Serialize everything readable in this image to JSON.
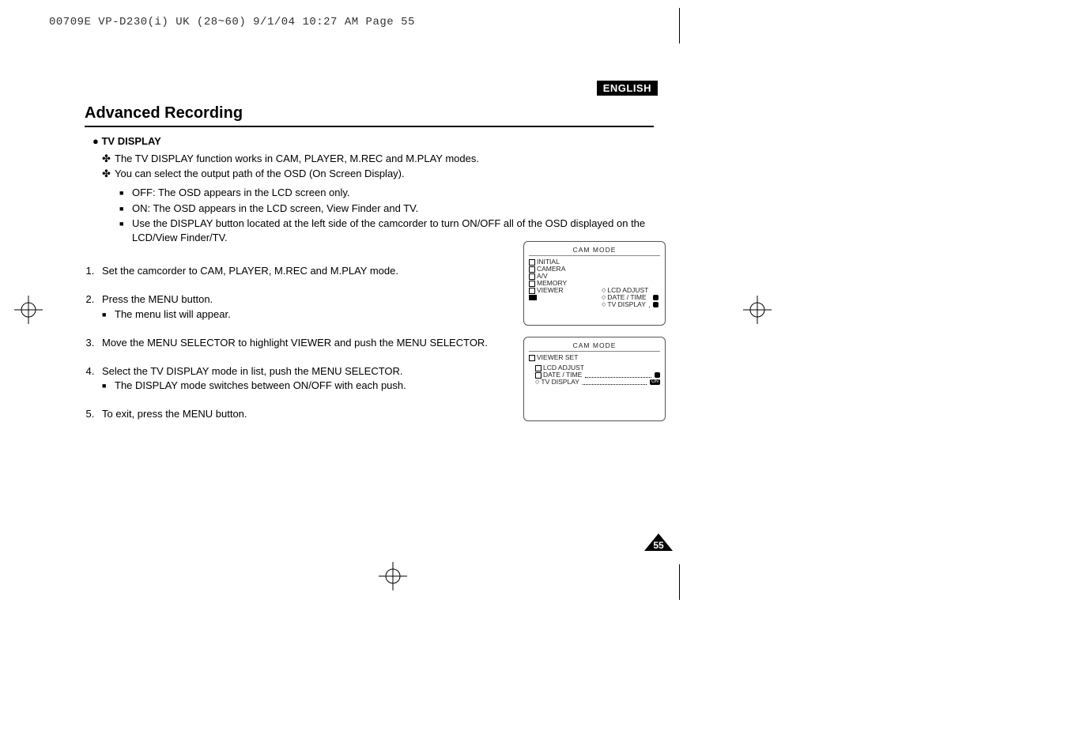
{
  "print_header": "00709E VP-D230(i) UK (28~60)  9/1/04 10:27 AM  Page 55",
  "language_badge": "ENGLISH",
  "section_title": "Advanced Recording",
  "sub_heading": "TV DISPLAY",
  "intro_bullets": [
    "The TV DISPLAY function works in CAM, PLAYER, M.REC and M.PLAY modes.",
    "You can select the output path of the OSD (On Screen Display)."
  ],
  "intro_squares": [
    "OFF: The OSD appears in the LCD screen only.",
    "ON: The OSD appears in the LCD screen, View Finder and TV.",
    "Use the DISPLAY button located at the left side of the camcorder to turn ON/OFF all of the OSD displayed on the LCD/View Finder/TV."
  ],
  "steps": [
    {
      "text": "Set the camcorder to CAM, PLAYER, M.REC and M.PLAY mode."
    },
    {
      "text": "Press the MENU button.",
      "sub": [
        "The menu list will appear."
      ]
    },
    {
      "text": "Move the MENU SELECTOR to highlight VIEWER and push the MENU SELECTOR."
    },
    {
      "text": "Select the TV DISPLAY mode in list, push the MENU SELECTOR.",
      "sub": [
        "The DISPLAY mode switches between ON/OFF with each push."
      ]
    },
    {
      "text": "To exit, press the MENU button."
    }
  ],
  "screen1": {
    "title": "CAM  MODE",
    "left_items": [
      "INITIAL",
      "CAMERA",
      "A/V",
      "MEMORY",
      "VIEWER"
    ],
    "right_items": [
      "LCD ADJUST",
      "DATE / TIME",
      "TV DISPLAY"
    ]
  },
  "screen2": {
    "title": "CAM  MODE",
    "heading": "VIEWER SET",
    "items": [
      {
        "label": "LCD ADJUST",
        "value": ""
      },
      {
        "label": "DATE / TIME",
        "value": ""
      },
      {
        "label": "TV DISPLAY",
        "value": "ON"
      }
    ]
  },
  "page_number": "55"
}
